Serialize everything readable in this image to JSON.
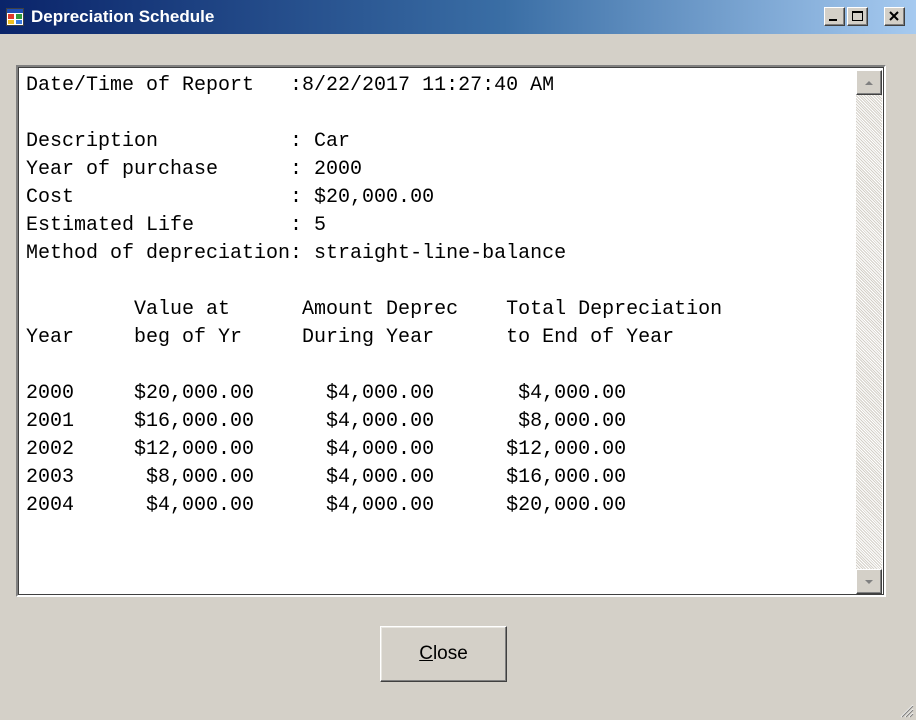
{
  "window": {
    "title": "Depreciation Schedule",
    "icon": "app-window-icon",
    "controls": [
      "minimize-icon",
      "maximize-icon",
      "close-icon"
    ]
  },
  "report": {
    "lines": [
      "Date/Time of Report   :8/22/2017 11:27:40 AM",
      "",
      "Description           : Car",
      "Year of purchase      : 2000",
      "Cost                  : $20,000.00",
      "Estimated Life        : 5",
      "Method of depreciation: straight-line-balance",
      "",
      "         Value at      Amount Deprec    Total Depreciation",
      "Year     beg of Yr     During Year      to End of Year",
      "",
      "2000     $20,000.00      $4,000.00       $4,000.00",
      "2001     $16,000.00      $4,000.00       $8,000.00",
      "2002     $12,000.00      $4,000.00      $12,000.00",
      "2003      $8,000.00      $4,000.00      $16,000.00",
      "2004      $4,000.00      $4,000.00      $20,000.00"
    ]
  },
  "close_button": {
    "mnemonic": "C",
    "rest": "lose"
  },
  "colors": {
    "titlebar_start": "#0a246a",
    "titlebar_end": "#a6caf0",
    "face": "#d4d0c8"
  }
}
